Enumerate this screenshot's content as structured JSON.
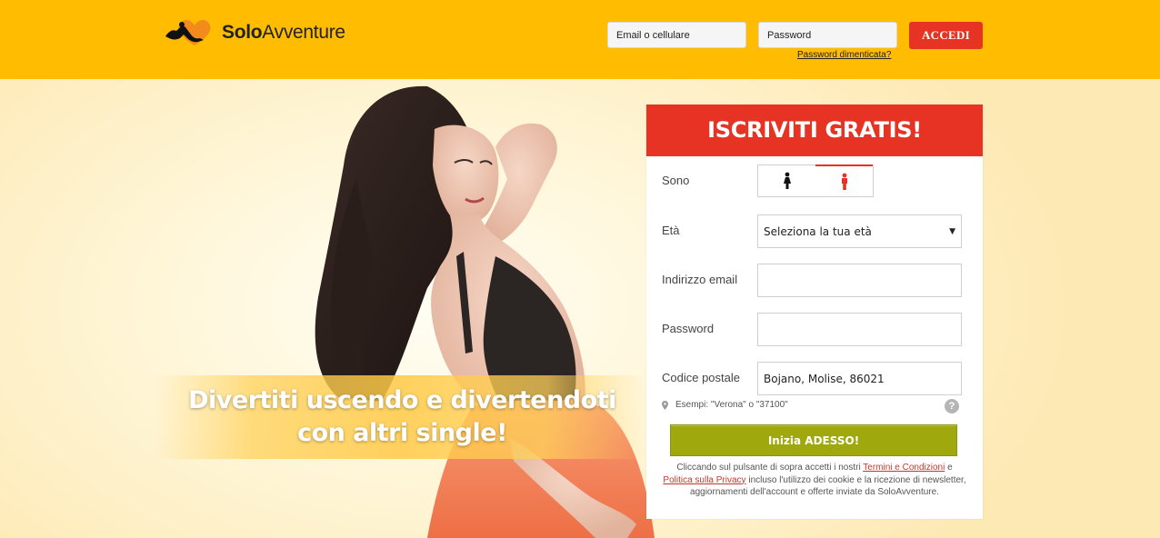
{
  "header": {
    "brand_bold": "Solo",
    "brand_light": "Avventure",
    "email_placeholder": "Email o cellulare",
    "password_placeholder": "Password",
    "login_label": "ACCEDI",
    "forgot_label": "Password dimenticata?"
  },
  "hero": {
    "tagline_line1": "Divertiti uscendo e divertendoti",
    "tagline_line2": "con altri single!"
  },
  "signup": {
    "title": "ISCRIVITI GRATIS!",
    "gender_label": "Sono",
    "gender_options": [
      {
        "icon": "woman-icon",
        "selected": false
      },
      {
        "icon": "man-icon",
        "selected": true
      }
    ],
    "age_label": "Età",
    "age_value": "Seleziona la tua età",
    "email_label": "Indirizzo email",
    "email_value": "",
    "password_label": "Password",
    "password_value": "",
    "zip_label": "Codice postale",
    "zip_value": "Bojano, Molise, 86021",
    "zip_hint": "Esempi: \"Verona\" o \"37100\"",
    "help_label": "?",
    "submit_label": "Inizia ADESSO!",
    "legal_pre": "Cliccando sul pulsante di sopra accetti i nostri ",
    "legal_terms": "Termini e Condizioni",
    "legal_and": " e ",
    "legal_privacy": "Politica sulla Privacy",
    "legal_post": " incluso l'utilizzo dei cookie e la ricezione di newsletter, aggiornamenti dell'account e offerte inviate da SoloAvventure."
  },
  "colors": {
    "header_bg": "#ffbc00",
    "accent_red": "#e63323",
    "submit_green": "#9fa80c"
  }
}
